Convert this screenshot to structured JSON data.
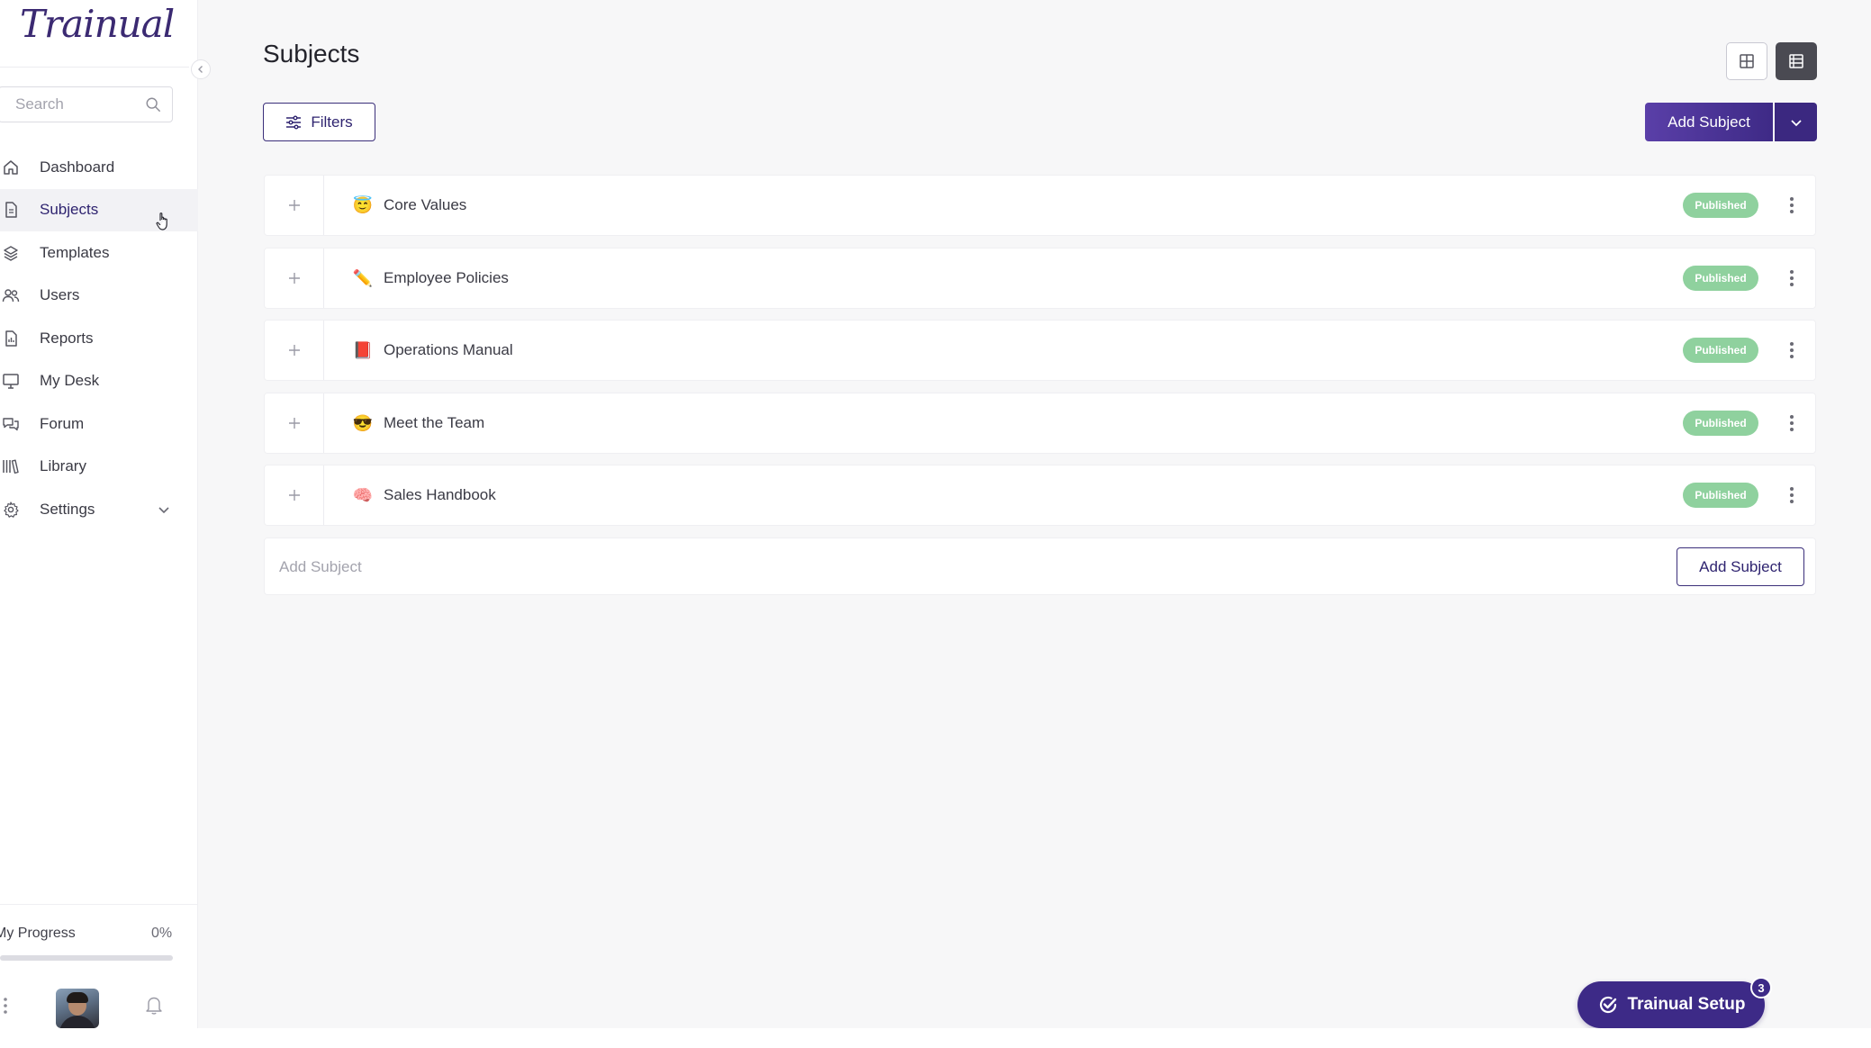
{
  "app": {
    "logo_text": "Trainual"
  },
  "sidebar": {
    "search": {
      "placeholder": "Search",
      "value": ""
    },
    "items": [
      {
        "label": "Dashboard",
        "icon": "home-icon",
        "active": false
      },
      {
        "label": "Subjects",
        "icon": "document-icon",
        "active": true
      },
      {
        "label": "Templates",
        "icon": "layers-icon",
        "active": false
      },
      {
        "label": "Users",
        "icon": "users-icon",
        "active": false
      },
      {
        "label": "Reports",
        "icon": "report-icon",
        "active": false
      },
      {
        "label": "My Desk",
        "icon": "monitor-icon",
        "active": false
      },
      {
        "label": "Forum",
        "icon": "chat-icon",
        "active": false
      },
      {
        "label": "Library",
        "icon": "library-icon",
        "active": false
      },
      {
        "label": "Settings",
        "icon": "gear-icon",
        "active": false,
        "has_submenu": true
      }
    ],
    "progress": {
      "label": "My Progress",
      "value_text": "0%",
      "fraction": 0
    }
  },
  "main": {
    "title": "Subjects",
    "filters_label": "Filters",
    "add_subject_label": "Add Subject",
    "subjects": [
      {
        "emoji": "😇",
        "name": "Core Values",
        "status": "Published"
      },
      {
        "emoji": "✏️",
        "name": "Employee Policies",
        "status": "Published"
      },
      {
        "emoji": "📕",
        "name": "Operations Manual",
        "status": "Published"
      },
      {
        "emoji": "😎",
        "name": "Meet the Team",
        "status": "Published"
      },
      {
        "emoji": "🧠",
        "name": "Sales Handbook",
        "status": "Published"
      }
    ],
    "new_subject": {
      "placeholder": "Add Subject",
      "button_label": "Add Subject"
    }
  },
  "setup": {
    "label": "Trainual Setup",
    "badge": "3"
  },
  "colors": {
    "brand": "#3d2a87",
    "published": "#8fd19e",
    "active_nav_bg": "#f2f2f5"
  }
}
